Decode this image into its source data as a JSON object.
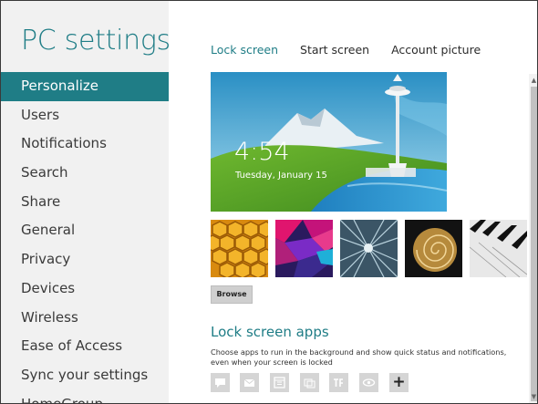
{
  "sidebar": {
    "title": "PC settings",
    "items": [
      {
        "label": "Personalize",
        "active": true
      },
      {
        "label": "Users"
      },
      {
        "label": "Notifications"
      },
      {
        "label": "Search"
      },
      {
        "label": "Share"
      },
      {
        "label": "General"
      },
      {
        "label": "Privacy"
      },
      {
        "label": "Devices"
      },
      {
        "label": "Wireless"
      },
      {
        "label": "Ease of Access"
      },
      {
        "label": "Sync your settings"
      },
      {
        "label": "HomeGroup"
      }
    ]
  },
  "main": {
    "tabs": [
      {
        "label": "Lock screen",
        "active": true
      },
      {
        "label": "Start screen"
      },
      {
        "label": "Account picture"
      }
    ],
    "lock_preview": {
      "time": "4:54",
      "date": "Tuesday, January 15"
    },
    "thumbnails": [
      "honeycomb-image",
      "geometric-pattern-image",
      "tunnel-image",
      "nautilus-shell-image",
      "piano-keys-image"
    ],
    "browse_label": "Browse",
    "lock_screen_apps": {
      "title": "Lock screen apps",
      "description": "Choose apps to run in the background and show quick status and notifications, even when your screen is locked",
      "slots": [
        "messaging-icon",
        "mail-icon",
        "calendar-icon",
        "people-icon",
        "photo-icon",
        "eye-icon",
        "add-icon"
      ]
    }
  },
  "colors": {
    "accent": "#1f7d86",
    "sidebar_bg": "#f1f1f1"
  }
}
